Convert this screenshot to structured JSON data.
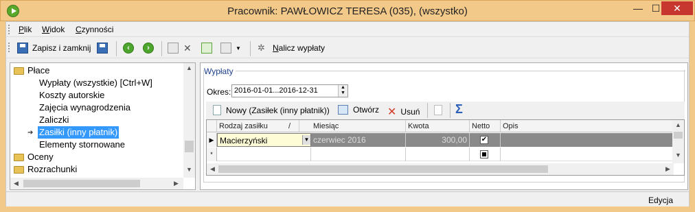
{
  "window": {
    "title": "Pracownik: PAWŁOWICZ TERESA (035), (wszystko)",
    "minimize": "—",
    "maximize": "☐",
    "close": "✕"
  },
  "menu": {
    "items": [
      {
        "label": "Plik",
        "underline": "P",
        "rest": "lik"
      },
      {
        "label": "Widok",
        "underline": "W",
        "rest": "idok"
      },
      {
        "label": "Czynności",
        "underline": "C",
        "rest": "zynności"
      }
    ]
  },
  "toolbar": {
    "save_close": "Zapisz i zamknij",
    "calculate": "Nalicz wypłaty",
    "calculate_underline": "N",
    "calculate_rest": "alicz wypłaty"
  },
  "tree": {
    "items": [
      {
        "label": "Płace",
        "type": "folder"
      },
      {
        "label": "Wypłaty (wszystkie) [Ctrl+W]",
        "type": "leaf"
      },
      {
        "label": "Koszty autorskie",
        "type": "leaf"
      },
      {
        "label": "Zajęcia wynagrodzenia",
        "type": "leaf"
      },
      {
        "label": "Zaliczki",
        "type": "leaf"
      },
      {
        "label": "Zasiłki (inny płatnik)",
        "type": "leaf",
        "selected": true
      },
      {
        "label": "Elementy stornowane",
        "type": "leaf"
      },
      {
        "label": "Oceny",
        "type": "folder"
      },
      {
        "label": "Rozrachunki",
        "type": "folder"
      }
    ]
  },
  "panel": {
    "group_title": "Wypłaty",
    "okres_label": "Okres:",
    "okres_value": "2016-01-01...2016-12-31",
    "buttons": {
      "new": "Nowy (Zasiłek (inny płatnik))",
      "open": "Otwórz",
      "delete": "Usuń"
    }
  },
  "grid": {
    "columns": [
      "Rodzaj zasiłku",
      "/",
      "Miesiąc",
      "Kwota",
      "Netto",
      "Opis"
    ],
    "rows": [
      {
        "rodzaj": "Macierzyński",
        "miesiac": "czerwiec 2016",
        "kwota": "300,00",
        "netto": "✔",
        "opis": ""
      }
    ],
    "new_row_marker": "*"
  },
  "status": {
    "mode": "Edycja"
  },
  "colors": {
    "title_bar": "#f3c98a",
    "selection": "#3399ff",
    "close_button": "#c7372f"
  }
}
